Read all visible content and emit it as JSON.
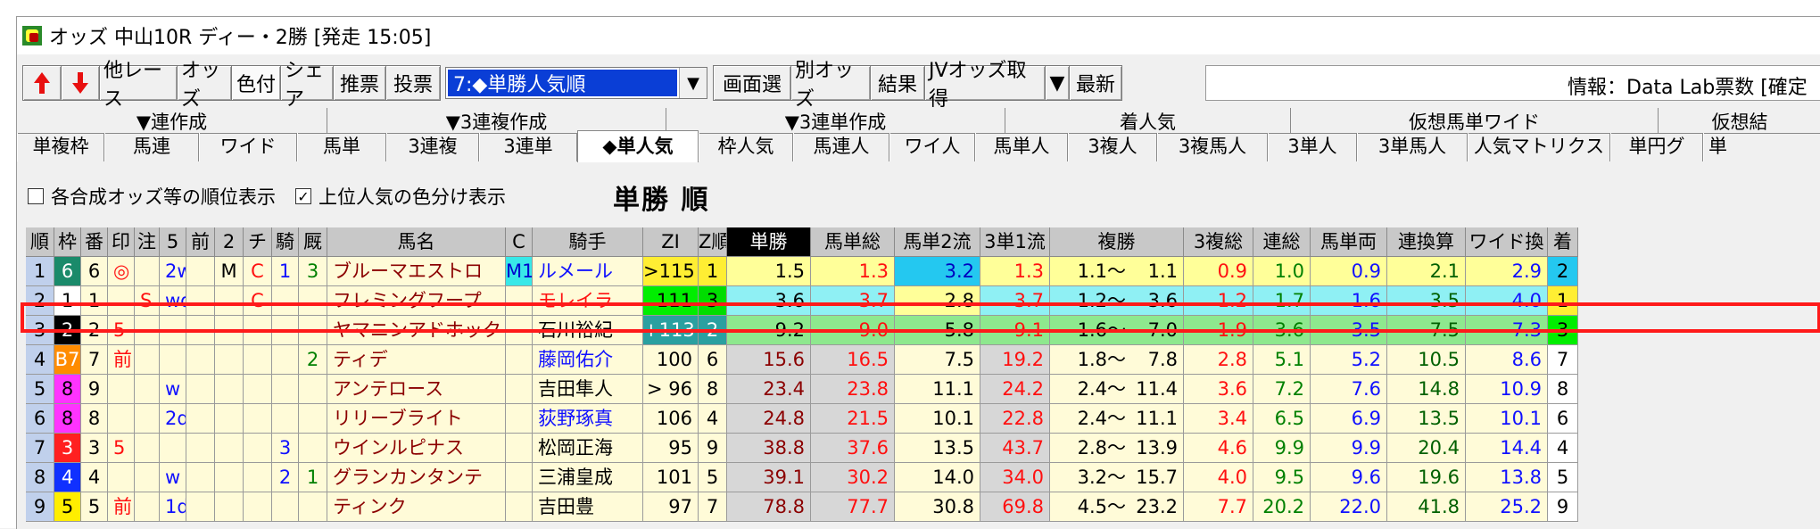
{
  "window": {
    "title": "オッズ 中山10R ディー・2勝 [発走 15:05]"
  },
  "toolbar": {
    "buttons": [
      "他レース",
      "オッズ",
      "色付",
      "シェア",
      "推票",
      "投票"
    ],
    "dropdown_value": "7:◆単勝人気順",
    "buttons2": [
      "画面選",
      "別オッズ",
      "結果",
      "JVオッズ取得",
      "最新"
    ],
    "info_text": "情報：Data Lab票数 [確定"
  },
  "tabs_row1": [
    "▼連作成",
    "▼3連複作成",
    "▼3連単作成",
    "着人気",
    "仮想馬単ワイド",
    "仮想結"
  ],
  "tabs_row2": [
    "単複枠",
    "馬連",
    "ワイド",
    "馬単",
    "3連複",
    "3連単",
    "◆単人気",
    "枠人気",
    "馬連人",
    "ワイ人",
    "馬単人",
    "3複人",
    "3複馬人",
    "3単人",
    "3単馬人",
    "人気マトリクス",
    "単円グ",
    "単"
  ],
  "options": {
    "cb1_label": "各合成オッズ等の順位表示",
    "cb2_label": "上位人気の色分け表示",
    "sort_title": "単勝 順"
  },
  "columns": [
    "順",
    "枠",
    "番",
    "印",
    "注",
    "5",
    "前",
    "2",
    "チ",
    "騎",
    "厩",
    "馬名",
    "C",
    "騎手",
    "ZI",
    "Z順",
    "単勝",
    "馬単総",
    "馬単2流",
    "3単1流",
    "複勝",
    "3複総",
    "連総",
    "馬単両",
    "連換算",
    "ワイド換",
    "着"
  ],
  "rows": [
    {
      "rank": "1",
      "waku": "6",
      "ban": "6",
      "mark": "◎",
      "chu": "",
      "g5": "2w",
      "mae": "",
      "g2": "M",
      "chi": "C",
      "ki": "1",
      "kyu": "3",
      "name": "ブルーマエストロ",
      "c": "M1",
      "jockey": "ルメール",
      "zi": ">115",
      "zr": "1",
      "tan": "1.5",
      "umatan": "1.3",
      "umatan2": "3.2",
      "san1": "1.3",
      "fuku_lo": "1.1～",
      "fuku_hi": "1.1",
      "sanpuku": "0.9",
      "ren": "1.0",
      "umaryo": "0.9",
      "renkan": "2.1",
      "wide": "2.9",
      "chaku": "2"
    },
    {
      "rank": "2",
      "waku": "1",
      "ban": "1",
      "mark": "",
      "chu": "S",
      "g5": "wd",
      "mae": "",
      "g2": "",
      "chi": "C",
      "ki": "",
      "kyu": "",
      "name": "フレミングフープ",
      "c": "",
      "jockey": "モレイラ",
      "zi": "111",
      "zr": "3",
      "tan": "3.6",
      "umatan": "3.7",
      "umatan2": "2.8",
      "san1": "3.7",
      "fuku_lo": "1.2～",
      "fuku_hi": "3.6",
      "sanpuku": "1.2",
      "ren": "1.7",
      "umaryo": "1.6",
      "renkan": "3.5",
      "wide": "4.0",
      "chaku": "1"
    },
    {
      "rank": "3",
      "waku": "2",
      "ban": "2",
      "mark": "5",
      "chu": "",
      "g5": "",
      "mae": "",
      "g2": "",
      "chi": "",
      "ki": "",
      "kyu": "",
      "name": "ヤマニンアドホック",
      "c": "",
      "jockey": "石川裕紀",
      "zi": "+113",
      "zr": "2",
      "tan": "9.2",
      "umatan": "9.0",
      "umatan2": "5.8",
      "san1": "9.1",
      "fuku_lo": "1.6～",
      "fuku_hi": "7.0",
      "sanpuku": "1.9",
      "ren": "3.6",
      "umaryo": "3.5",
      "renkan": "7.5",
      "wide": "7.3",
      "chaku": "3"
    },
    {
      "rank": "4",
      "waku": "B7",
      "ban": "7",
      "mark": "前",
      "chu": "",
      "g5": "",
      "mae": "",
      "g2": "",
      "chi": "",
      "ki": "",
      "kyu": "2",
      "name": "ティデ",
      "c": "",
      "jockey": "藤岡佑介",
      "zi": "100",
      "zr": "6",
      "tan": "15.6",
      "umatan": "16.5",
      "umatan2": "7.5",
      "san1": "19.2",
      "fuku_lo": "1.8～",
      "fuku_hi": "7.8",
      "sanpuku": "2.8",
      "ren": "5.1",
      "umaryo": "5.2",
      "renkan": "10.5",
      "wide": "8.6",
      "chaku": "7"
    },
    {
      "rank": "5",
      "waku": "8",
      "ban": "9",
      "mark": "",
      "chu": "",
      "g5": "w",
      "mae": "",
      "g2": "",
      "chi": "",
      "ki": "",
      "kyu": "",
      "name": "アンテロース",
      "c": "",
      "jockey": "吉田隼人",
      "zi": "> 96",
      "zr": "8",
      "tan": "23.4",
      "umatan": "23.8",
      "umatan2": "11.1",
      "san1": "24.2",
      "fuku_lo": "2.4～",
      "fuku_hi": "11.4",
      "sanpuku": "3.6",
      "ren": "7.2",
      "umaryo": "7.6",
      "renkan": "14.8",
      "wide": "10.9",
      "chaku": "8"
    },
    {
      "rank": "6",
      "waku": "8",
      "ban": "8",
      "mark": "",
      "chu": "",
      "g5": "2d",
      "mae": "",
      "g2": "",
      "chi": "",
      "ki": "",
      "kyu": "",
      "name": "リリーブライト",
      "c": "",
      "jockey": "荻野琢真",
      "zi": "106",
      "zr": "4",
      "tan": "24.8",
      "umatan": "21.5",
      "umatan2": "10.1",
      "san1": "22.8",
      "fuku_lo": "2.4～",
      "fuku_hi": "11.1",
      "sanpuku": "3.4",
      "ren": "6.5",
      "umaryo": "6.9",
      "renkan": "13.5",
      "wide": "10.1",
      "chaku": "6"
    },
    {
      "rank": "7",
      "waku": "3",
      "ban": "3",
      "mark": "5",
      "chu": "",
      "g5": "",
      "mae": "",
      "g2": "",
      "chi": "",
      "ki": "3",
      "kyu": "",
      "name": "ウインルピナス",
      "c": "",
      "jockey": "松岡正海",
      "zi": "95",
      "zr": "9",
      "tan": "38.8",
      "umatan": "37.6",
      "umatan2": "13.5",
      "san1": "43.7",
      "fuku_lo": "2.8～",
      "fuku_hi": "13.9",
      "sanpuku": "4.6",
      "ren": "9.9",
      "umaryo": "9.9",
      "renkan": "20.4",
      "wide": "14.4",
      "chaku": "4"
    },
    {
      "rank": "8",
      "waku": "4",
      "ban": "4",
      "mark": "",
      "chu": "",
      "g5": "w",
      "mae": "",
      "g2": "",
      "chi": "",
      "ki": "2",
      "kyu": "1",
      "name": "グランカンタンテ",
      "c": "",
      "jockey": "三浦皇成",
      "zi": "101",
      "zr": "5",
      "tan": "39.1",
      "umatan": "30.2",
      "umatan2": "14.0",
      "san1": "34.0",
      "fuku_lo": "3.2～",
      "fuku_hi": "15.7",
      "sanpuku": "4.0",
      "ren": "9.5",
      "umaryo": "9.6",
      "renkan": "19.6",
      "wide": "13.8",
      "chaku": "5"
    },
    {
      "rank": "9",
      "waku": "5",
      "ban": "5",
      "mark": "前",
      "chu": "",
      "g5": "1d",
      "mae": "",
      "g2": "",
      "chi": "",
      "ki": "",
      "kyu": "",
      "name": "ティンク",
      "c": "",
      "jockey": "吉田豊",
      "zi": "97",
      "zr": "7",
      "tan": "78.8",
      "umatan": "77.7",
      "umatan2": "30.8",
      "san1": "69.8",
      "fuku_lo": "4.5～",
      "fuku_hi": "23.2",
      "sanpuku": "7.7",
      "ren": "20.2",
      "umaryo": "22.0",
      "renkan": "41.8",
      "wide": "25.2",
      "chaku": "9"
    }
  ],
  "colors": {
    "waku_bg": {
      "1": "#ffffff",
      "2": "#000000",
      "3": "#ff2020",
      "4": "#1030ff",
      "5": "#ffee00",
      "6": "#1a8a6a",
      "7": "#ff8c00",
      "8": "#ff33ff"
    },
    "waku_fg": {
      "1": "#000000",
      "2": "#ffffff",
      "3": "#ffffff",
      "4": "#ffffff",
      "5": "#000000",
      "6": "#ffffff",
      "7": "#ffffff",
      "8": "#000000"
    },
    "selection_border": "#ff1a1a"
  }
}
